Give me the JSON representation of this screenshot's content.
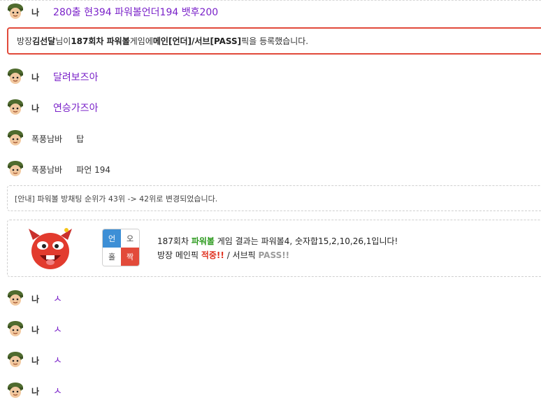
{
  "messages": [
    {
      "nick": "나",
      "text": "280출 현394 파워볼언더194 뱃후200"
    },
    {
      "nick": "나",
      "text": "달려보즈아"
    },
    {
      "nick": "나",
      "text": "연승가즈아"
    },
    {
      "nick": "폭풍남바",
      "text": "탑"
    },
    {
      "nick": "폭풍남바",
      "text": "파언 194"
    },
    {
      "nick": "나",
      "text": "ㅅ"
    },
    {
      "nick": "나",
      "text": "ㅅ"
    },
    {
      "nick": "나",
      "text": "ㅅ"
    },
    {
      "nick": "나",
      "text": "ㅅ"
    }
  ],
  "pick_notice": {
    "prefix": "방장 ",
    "host_name": "김선달",
    "mid1": "님이 ",
    "round": "187회차 파워볼",
    "mid2": " 게임에 ",
    "main_pick": "메인[언더]/",
    "space": " ",
    "sub_pick": "서브[PASS]",
    "suffix": " 픽을 등록했습니다."
  },
  "rank_notice": "[안내] 파워볼 방채팅 순위가 43위 -> 42위로 변경되었습니다.",
  "result": {
    "grid": {
      "tl": "언",
      "tr": "오",
      "bl": "홀",
      "br": "짝"
    },
    "line1_a": "187회차 ",
    "line1_b": "파워볼",
    "line1_c": " 게임 결과는 파워볼4, 숫자합15,2,10,26,1입니다!",
    "line2_a": "방장 메인픽 ",
    "line2_b": "적중!!",
    "line2_c": " / 서브픽 ",
    "line2_d": "PASS!!"
  },
  "colors": {
    "accent_purple": "#7a22c9",
    "alert_red": "#e14a3a",
    "hit_red": "#e0311f",
    "powerball_green": "#2c9a1e",
    "odd_even_blue": "#3d8fd6"
  }
}
